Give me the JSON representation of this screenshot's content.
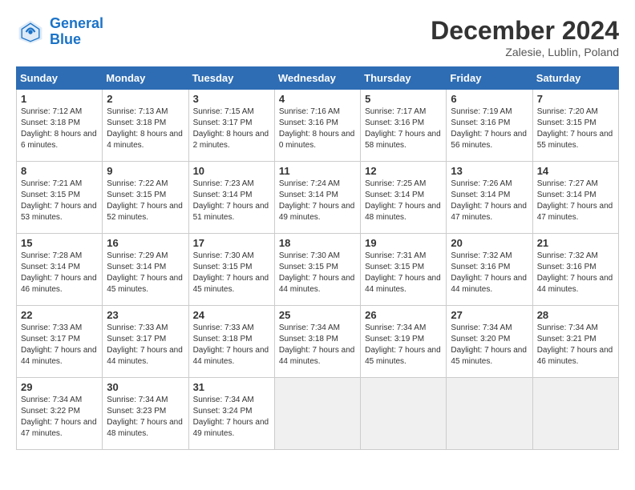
{
  "header": {
    "logo_line1": "General",
    "logo_line2": "Blue",
    "month": "December 2024",
    "location": "Zalesie, Lublin, Poland"
  },
  "days_of_week": [
    "Sunday",
    "Monday",
    "Tuesday",
    "Wednesday",
    "Thursday",
    "Friday",
    "Saturday"
  ],
  "weeks": [
    [
      {
        "day": 1,
        "rise": "7:12 AM",
        "set": "3:18 PM",
        "daylight": "8 hours and 6 minutes."
      },
      {
        "day": 2,
        "rise": "7:13 AM",
        "set": "3:18 PM",
        "daylight": "8 hours and 4 minutes."
      },
      {
        "day": 3,
        "rise": "7:15 AM",
        "set": "3:17 PM",
        "daylight": "8 hours and 2 minutes."
      },
      {
        "day": 4,
        "rise": "7:16 AM",
        "set": "3:16 PM",
        "daylight": "8 hours and 0 minutes."
      },
      {
        "day": 5,
        "rise": "7:17 AM",
        "set": "3:16 PM",
        "daylight": "7 hours and 58 minutes."
      },
      {
        "day": 6,
        "rise": "7:19 AM",
        "set": "3:16 PM",
        "daylight": "7 hours and 56 minutes."
      },
      {
        "day": 7,
        "rise": "7:20 AM",
        "set": "3:15 PM",
        "daylight": "7 hours and 55 minutes."
      }
    ],
    [
      {
        "day": 8,
        "rise": "7:21 AM",
        "set": "3:15 PM",
        "daylight": "7 hours and 53 minutes."
      },
      {
        "day": 9,
        "rise": "7:22 AM",
        "set": "3:15 PM",
        "daylight": "7 hours and 52 minutes."
      },
      {
        "day": 10,
        "rise": "7:23 AM",
        "set": "3:14 PM",
        "daylight": "7 hours and 51 minutes."
      },
      {
        "day": 11,
        "rise": "7:24 AM",
        "set": "3:14 PM",
        "daylight": "7 hours and 49 minutes."
      },
      {
        "day": 12,
        "rise": "7:25 AM",
        "set": "3:14 PM",
        "daylight": "7 hours and 48 minutes."
      },
      {
        "day": 13,
        "rise": "7:26 AM",
        "set": "3:14 PM",
        "daylight": "7 hours and 47 minutes."
      },
      {
        "day": 14,
        "rise": "7:27 AM",
        "set": "3:14 PM",
        "daylight": "7 hours and 47 minutes."
      }
    ],
    [
      {
        "day": 15,
        "rise": "7:28 AM",
        "set": "3:14 PM",
        "daylight": "7 hours and 46 minutes."
      },
      {
        "day": 16,
        "rise": "7:29 AM",
        "set": "3:14 PM",
        "daylight": "7 hours and 45 minutes."
      },
      {
        "day": 17,
        "rise": "7:30 AM",
        "set": "3:15 PM",
        "daylight": "7 hours and 45 minutes."
      },
      {
        "day": 18,
        "rise": "7:30 AM",
        "set": "3:15 PM",
        "daylight": "7 hours and 44 minutes."
      },
      {
        "day": 19,
        "rise": "7:31 AM",
        "set": "3:15 PM",
        "daylight": "7 hours and 44 minutes."
      },
      {
        "day": 20,
        "rise": "7:32 AM",
        "set": "3:16 PM",
        "daylight": "7 hours and 44 minutes."
      },
      {
        "day": 21,
        "rise": "7:32 AM",
        "set": "3:16 PM",
        "daylight": "7 hours and 44 minutes."
      }
    ],
    [
      {
        "day": 22,
        "rise": "7:33 AM",
        "set": "3:17 PM",
        "daylight": "7 hours and 44 minutes."
      },
      {
        "day": 23,
        "rise": "7:33 AM",
        "set": "3:17 PM",
        "daylight": "7 hours and 44 minutes."
      },
      {
        "day": 24,
        "rise": "7:33 AM",
        "set": "3:18 PM",
        "daylight": "7 hours and 44 minutes."
      },
      {
        "day": 25,
        "rise": "7:34 AM",
        "set": "3:18 PM",
        "daylight": "7 hours and 44 minutes."
      },
      {
        "day": 26,
        "rise": "7:34 AM",
        "set": "3:19 PM",
        "daylight": "7 hours and 45 minutes."
      },
      {
        "day": 27,
        "rise": "7:34 AM",
        "set": "3:20 PM",
        "daylight": "7 hours and 45 minutes."
      },
      {
        "day": 28,
        "rise": "7:34 AM",
        "set": "3:21 PM",
        "daylight": "7 hours and 46 minutes."
      }
    ],
    [
      {
        "day": 29,
        "rise": "7:34 AM",
        "set": "3:22 PM",
        "daylight": "7 hours and 47 minutes."
      },
      {
        "day": 30,
        "rise": "7:34 AM",
        "set": "3:23 PM",
        "daylight": "7 hours and 48 minutes."
      },
      {
        "day": 31,
        "rise": "7:34 AM",
        "set": "3:24 PM",
        "daylight": "7 hours and 49 minutes."
      },
      null,
      null,
      null,
      null
    ]
  ]
}
